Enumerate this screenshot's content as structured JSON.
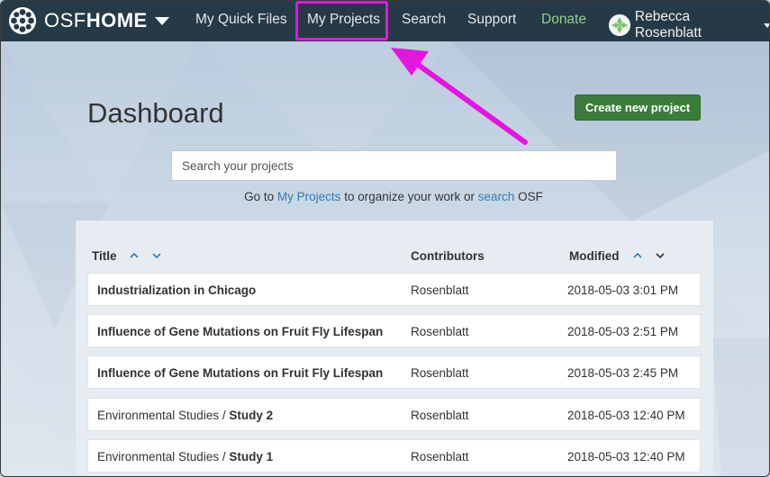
{
  "navbar": {
    "brand_light": "OSF",
    "brand_bold": "HOME",
    "items": [
      {
        "label": "My Quick Files"
      },
      {
        "label": "My Projects"
      },
      {
        "label": "Search"
      },
      {
        "label": "Support"
      },
      {
        "label": "Donate"
      }
    ],
    "user_name": "Rebecca Rosenblatt"
  },
  "dashboard": {
    "title": "Dashboard",
    "create_button": "Create new project",
    "search_placeholder": "Search your projects",
    "goto_prefix": "Go to",
    "goto_link1": "My Projects",
    "goto_middle": "to organize your work or",
    "goto_link2": "search",
    "goto_suffix": "OSF"
  },
  "table": {
    "headers": {
      "title": "Title",
      "contributors": "Contributors",
      "modified": "Modified"
    },
    "rows": [
      {
        "prefix": "",
        "name": "Industrialization in Chicago",
        "contributors": "Rosenblatt",
        "modified": "2018-05-03 3:01 PM"
      },
      {
        "prefix": "",
        "name": "Influence of Gene Mutations on Fruit Fly Lifespan",
        "contributors": "Rosenblatt",
        "modified": "2018-05-03 2:51 PM"
      },
      {
        "prefix": "",
        "name": "Influence of Gene Mutations on Fruit Fly Lifespan",
        "contributors": "Rosenblatt",
        "modified": "2018-05-03 2:45 PM"
      },
      {
        "prefix": "Environmental Studies / ",
        "name": "Study 2",
        "contributors": "Rosenblatt",
        "modified": "2018-05-03 12:40 PM"
      },
      {
        "prefix": "Environmental Studies / ",
        "name": "Study 1",
        "contributors": "Rosenblatt",
        "modified": "2018-05-03 12:40 PM"
      }
    ]
  },
  "colors": {
    "navbar_bg": "#263947",
    "donate": "#8fd08d",
    "create_button": "#3a7d3a",
    "link": "#337ab7",
    "annotation": "#e515e0"
  }
}
